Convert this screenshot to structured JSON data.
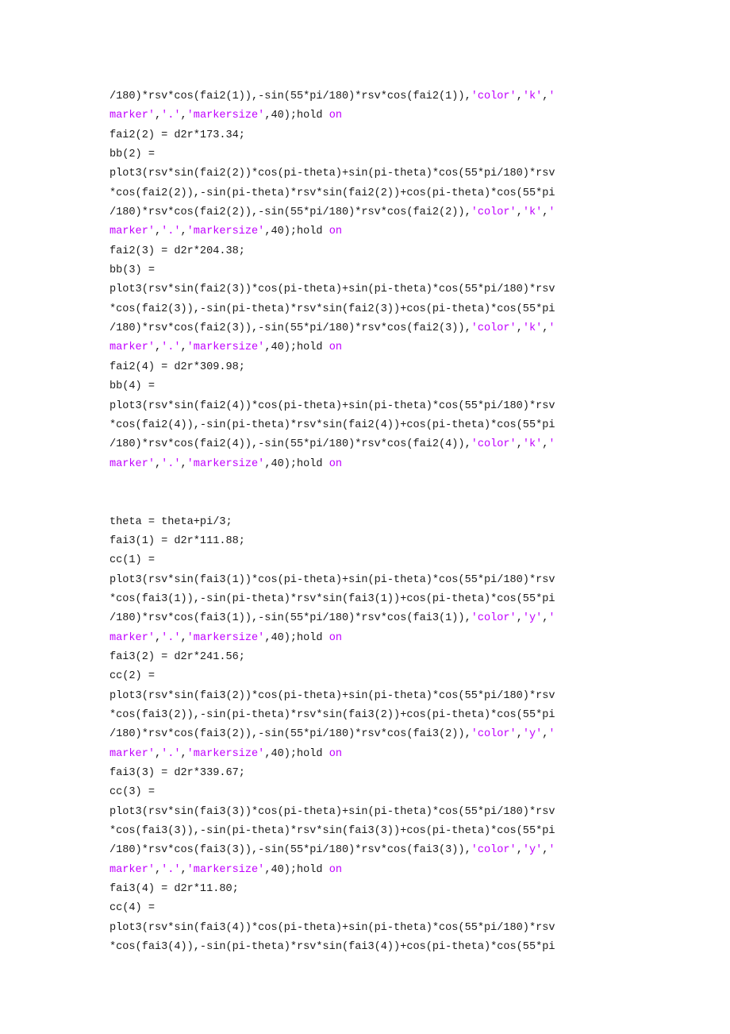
{
  "document": {
    "type": "code-listing",
    "language": "MATLAB",
    "background_color": "#ffffff",
    "text_color": "#1a1a1a",
    "string_color": "#c000ff",
    "keyword_color": "#c000ff"
  },
  "lines": [
    {
      "segments": [
        {
          "t": "plain",
          "s": "/180)*rsv*cos(fai2(1)),-sin(55*pi/180)*rsv*cos(fai2(1)),"
        },
        {
          "t": "string",
          "s": "'color'"
        },
        {
          "t": "plain",
          "s": ","
        },
        {
          "t": "string",
          "s": "'k'"
        },
        {
          "t": "plain",
          "s": ","
        },
        {
          "t": "string",
          "s": "'"
        }
      ]
    },
    {
      "segments": [
        {
          "t": "string",
          "s": "marker'"
        },
        {
          "t": "plain",
          "s": ","
        },
        {
          "t": "string",
          "s": "'.'"
        },
        {
          "t": "plain",
          "s": ","
        },
        {
          "t": "string",
          "s": "'markersize'"
        },
        {
          "t": "plain",
          "s": ",40);hold "
        },
        {
          "t": "keyword",
          "s": "on"
        }
      ]
    },
    {
      "segments": [
        {
          "t": "plain",
          "s": "fai2(2) = d2r*173.34;"
        }
      ]
    },
    {
      "segments": [
        {
          "t": "plain",
          "s": "bb(2) ="
        }
      ]
    },
    {
      "segments": [
        {
          "t": "plain",
          "s": "plot3(rsv*sin(fai2(2))*cos(pi-theta)+sin(pi-theta)*cos(55*pi/180)*rsv"
        }
      ]
    },
    {
      "segments": [
        {
          "t": "plain",
          "s": "*cos(fai2(2)),-sin(pi-theta)*rsv*sin(fai2(2))+cos(pi-theta)*cos(55*pi"
        }
      ]
    },
    {
      "segments": [
        {
          "t": "plain",
          "s": "/180)*rsv*cos(fai2(2)),-sin(55*pi/180)*rsv*cos(fai2(2)),"
        },
        {
          "t": "string",
          "s": "'color'"
        },
        {
          "t": "plain",
          "s": ","
        },
        {
          "t": "string",
          "s": "'k'"
        },
        {
          "t": "plain",
          "s": ","
        },
        {
          "t": "string",
          "s": "'"
        }
      ]
    },
    {
      "segments": [
        {
          "t": "string",
          "s": "marker'"
        },
        {
          "t": "plain",
          "s": ","
        },
        {
          "t": "string",
          "s": "'.'"
        },
        {
          "t": "plain",
          "s": ","
        },
        {
          "t": "string",
          "s": "'markersize'"
        },
        {
          "t": "plain",
          "s": ",40);hold "
        },
        {
          "t": "keyword",
          "s": "on"
        }
      ]
    },
    {
      "segments": [
        {
          "t": "plain",
          "s": "fai2(3) = d2r*204.38;"
        }
      ]
    },
    {
      "segments": [
        {
          "t": "plain",
          "s": "bb(3) ="
        }
      ]
    },
    {
      "segments": [
        {
          "t": "plain",
          "s": "plot3(rsv*sin(fai2(3))*cos(pi-theta)+sin(pi-theta)*cos(55*pi/180)*rsv"
        }
      ]
    },
    {
      "segments": [
        {
          "t": "plain",
          "s": "*cos(fai2(3)),-sin(pi-theta)*rsv*sin(fai2(3))+cos(pi-theta)*cos(55*pi"
        }
      ]
    },
    {
      "segments": [
        {
          "t": "plain",
          "s": "/180)*rsv*cos(fai2(3)),-sin(55*pi/180)*rsv*cos(fai2(3)),"
        },
        {
          "t": "string",
          "s": "'color'"
        },
        {
          "t": "plain",
          "s": ","
        },
        {
          "t": "string",
          "s": "'k'"
        },
        {
          "t": "plain",
          "s": ","
        },
        {
          "t": "string",
          "s": "'"
        }
      ]
    },
    {
      "segments": [
        {
          "t": "string",
          "s": "marker'"
        },
        {
          "t": "plain",
          "s": ","
        },
        {
          "t": "string",
          "s": "'.'"
        },
        {
          "t": "plain",
          "s": ","
        },
        {
          "t": "string",
          "s": "'markersize'"
        },
        {
          "t": "plain",
          "s": ",40);hold "
        },
        {
          "t": "keyword",
          "s": "on"
        }
      ]
    },
    {
      "segments": [
        {
          "t": "plain",
          "s": "fai2(4) = d2r*309.98;"
        }
      ]
    },
    {
      "segments": [
        {
          "t": "plain",
          "s": "bb(4) ="
        }
      ]
    },
    {
      "segments": [
        {
          "t": "plain",
          "s": "plot3(rsv*sin(fai2(4))*cos(pi-theta)+sin(pi-theta)*cos(55*pi/180)*rsv"
        }
      ]
    },
    {
      "segments": [
        {
          "t": "plain",
          "s": "*cos(fai2(4)),-sin(pi-theta)*rsv*sin(fai2(4))+cos(pi-theta)*cos(55*pi"
        }
      ]
    },
    {
      "segments": [
        {
          "t": "plain",
          "s": "/180)*rsv*cos(fai2(4)),-sin(55*pi/180)*rsv*cos(fai2(4)),"
        },
        {
          "t": "string",
          "s": "'color'"
        },
        {
          "t": "plain",
          "s": ","
        },
        {
          "t": "string",
          "s": "'k'"
        },
        {
          "t": "plain",
          "s": ","
        },
        {
          "t": "string",
          "s": "'"
        }
      ]
    },
    {
      "segments": [
        {
          "t": "string",
          "s": "marker'"
        },
        {
          "t": "plain",
          "s": ","
        },
        {
          "t": "string",
          "s": "'.'"
        },
        {
          "t": "plain",
          "s": ","
        },
        {
          "t": "string",
          "s": "'markersize'"
        },
        {
          "t": "plain",
          "s": ",40);hold "
        },
        {
          "t": "keyword",
          "s": "on"
        }
      ]
    },
    {
      "segments": []
    },
    {
      "segments": []
    },
    {
      "segments": [
        {
          "t": "plain",
          "s": "theta = theta+pi/3;"
        }
      ]
    },
    {
      "segments": [
        {
          "t": "plain",
          "s": "fai3(1) = d2r*111.88;"
        }
      ]
    },
    {
      "segments": [
        {
          "t": "plain",
          "s": "cc(1) ="
        }
      ]
    },
    {
      "segments": [
        {
          "t": "plain",
          "s": "plot3(rsv*sin(fai3(1))*cos(pi-theta)+sin(pi-theta)*cos(55*pi/180)*rsv"
        }
      ]
    },
    {
      "segments": [
        {
          "t": "plain",
          "s": "*cos(fai3(1)),-sin(pi-theta)*rsv*sin(fai3(1))+cos(pi-theta)*cos(55*pi"
        }
      ]
    },
    {
      "segments": [
        {
          "t": "plain",
          "s": "/180)*rsv*cos(fai3(1)),-sin(55*pi/180)*rsv*cos(fai3(1)),"
        },
        {
          "t": "string",
          "s": "'color'"
        },
        {
          "t": "plain",
          "s": ","
        },
        {
          "t": "string",
          "s": "'y'"
        },
        {
          "t": "plain",
          "s": ","
        },
        {
          "t": "string",
          "s": "'"
        }
      ]
    },
    {
      "segments": [
        {
          "t": "string",
          "s": "marker'"
        },
        {
          "t": "plain",
          "s": ","
        },
        {
          "t": "string",
          "s": "'.'"
        },
        {
          "t": "plain",
          "s": ","
        },
        {
          "t": "string",
          "s": "'markersize'"
        },
        {
          "t": "plain",
          "s": ",40);hold "
        },
        {
          "t": "keyword",
          "s": "on"
        }
      ]
    },
    {
      "segments": [
        {
          "t": "plain",
          "s": "fai3(2) = d2r*241.56;"
        }
      ]
    },
    {
      "segments": [
        {
          "t": "plain",
          "s": "cc(2) ="
        }
      ]
    },
    {
      "segments": [
        {
          "t": "plain",
          "s": "plot3(rsv*sin(fai3(2))*cos(pi-theta)+sin(pi-theta)*cos(55*pi/180)*rsv"
        }
      ]
    },
    {
      "segments": [
        {
          "t": "plain",
          "s": "*cos(fai3(2)),-sin(pi-theta)*rsv*sin(fai3(2))+cos(pi-theta)*cos(55*pi"
        }
      ]
    },
    {
      "segments": [
        {
          "t": "plain",
          "s": "/180)*rsv*cos(fai3(2)),-sin(55*pi/180)*rsv*cos(fai3(2)),"
        },
        {
          "t": "string",
          "s": "'color'"
        },
        {
          "t": "plain",
          "s": ","
        },
        {
          "t": "string",
          "s": "'y'"
        },
        {
          "t": "plain",
          "s": ","
        },
        {
          "t": "string",
          "s": "'"
        }
      ]
    },
    {
      "segments": [
        {
          "t": "string",
          "s": "marker'"
        },
        {
          "t": "plain",
          "s": ","
        },
        {
          "t": "string",
          "s": "'.'"
        },
        {
          "t": "plain",
          "s": ","
        },
        {
          "t": "string",
          "s": "'markersize'"
        },
        {
          "t": "plain",
          "s": ",40);hold "
        },
        {
          "t": "keyword",
          "s": "on"
        }
      ]
    },
    {
      "segments": [
        {
          "t": "plain",
          "s": "fai3(3) = d2r*339.67;"
        }
      ]
    },
    {
      "segments": [
        {
          "t": "plain",
          "s": "cc(3) ="
        }
      ]
    },
    {
      "segments": [
        {
          "t": "plain",
          "s": "plot3(rsv*sin(fai3(3))*cos(pi-theta)+sin(pi-theta)*cos(55*pi/180)*rsv"
        }
      ]
    },
    {
      "segments": [
        {
          "t": "plain",
          "s": "*cos(fai3(3)),-sin(pi-theta)*rsv*sin(fai3(3))+cos(pi-theta)*cos(55*pi"
        }
      ]
    },
    {
      "segments": [
        {
          "t": "plain",
          "s": "/180)*rsv*cos(fai3(3)),-sin(55*pi/180)*rsv*cos(fai3(3)),"
        },
        {
          "t": "string",
          "s": "'color'"
        },
        {
          "t": "plain",
          "s": ","
        },
        {
          "t": "string",
          "s": "'y'"
        },
        {
          "t": "plain",
          "s": ","
        },
        {
          "t": "string",
          "s": "'"
        }
      ]
    },
    {
      "segments": [
        {
          "t": "string",
          "s": "marker'"
        },
        {
          "t": "plain",
          "s": ","
        },
        {
          "t": "string",
          "s": "'.'"
        },
        {
          "t": "plain",
          "s": ","
        },
        {
          "t": "string",
          "s": "'markersize'"
        },
        {
          "t": "plain",
          "s": ",40);hold "
        },
        {
          "t": "keyword",
          "s": "on"
        }
      ]
    },
    {
      "segments": [
        {
          "t": "plain",
          "s": "fai3(4) = d2r*11.80;"
        }
      ]
    },
    {
      "segments": [
        {
          "t": "plain",
          "s": "cc(4) ="
        }
      ]
    },
    {
      "segments": [
        {
          "t": "plain",
          "s": "plot3(rsv*sin(fai3(4))*cos(pi-theta)+sin(pi-theta)*cos(55*pi/180)*rsv"
        }
      ]
    },
    {
      "segments": [
        {
          "t": "plain",
          "s": "*cos(fai3(4)),-sin(pi-theta)*rsv*sin(fai3(4))+cos(pi-theta)*cos(55*pi"
        }
      ]
    }
  ]
}
